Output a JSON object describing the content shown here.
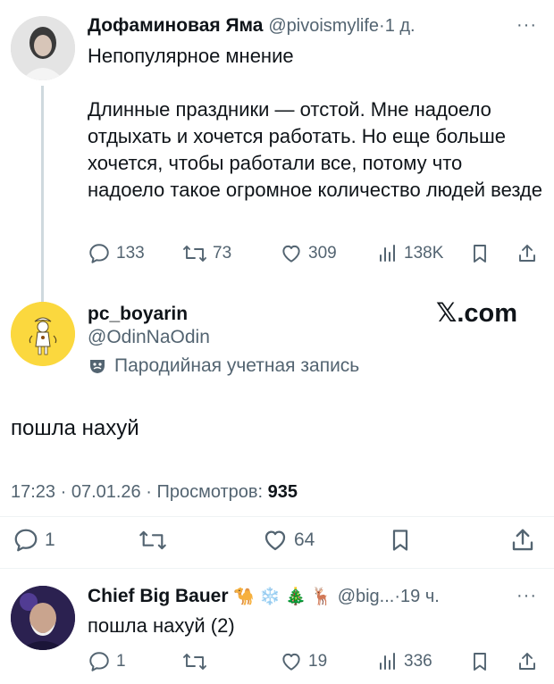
{
  "quoted_tweet": {
    "author_name": "Дофаминовая Яма",
    "handle": "@pivoismylife",
    "separator": "·",
    "time": "1 д.",
    "more": "···",
    "text": "Непопулярное мнение\n\nДлинные праздники — отстой. Мне надоело отдыхать и хочется работать. Но еще больше хочется, чтобы работали все, потому что надоело такое огромное количество людей везде",
    "replies": "133",
    "retweets": "73",
    "likes": "309",
    "views": "138K"
  },
  "main_tweet": {
    "author_name": "pc_boyarin",
    "handle": "@OdinNaOdin",
    "parody_label": "Пародийная учетная запись",
    "brand": "𝕏.com",
    "text": "пошла нахуй",
    "time": "17:23 · 07.01.26 · Просмотров: ",
    "views": "935",
    "replies": "1",
    "likes": "64"
  },
  "reply_tweet": {
    "author_name": "Chief Big Bauer",
    "emojis": "🐪 ❄️ 🎄 🦌",
    "handle": "@big...",
    "separator": "·",
    "time": "19 ч.",
    "more": "···",
    "text": "пошла нахуй (2)",
    "replies": "1",
    "likes": "19",
    "views": "336"
  },
  "colors": {
    "text": "#0f1419",
    "muted": "#536471",
    "divider": "#cfd9de",
    "thread_line": "#cfd9de",
    "avatar_yellow": "#fbd83e"
  }
}
